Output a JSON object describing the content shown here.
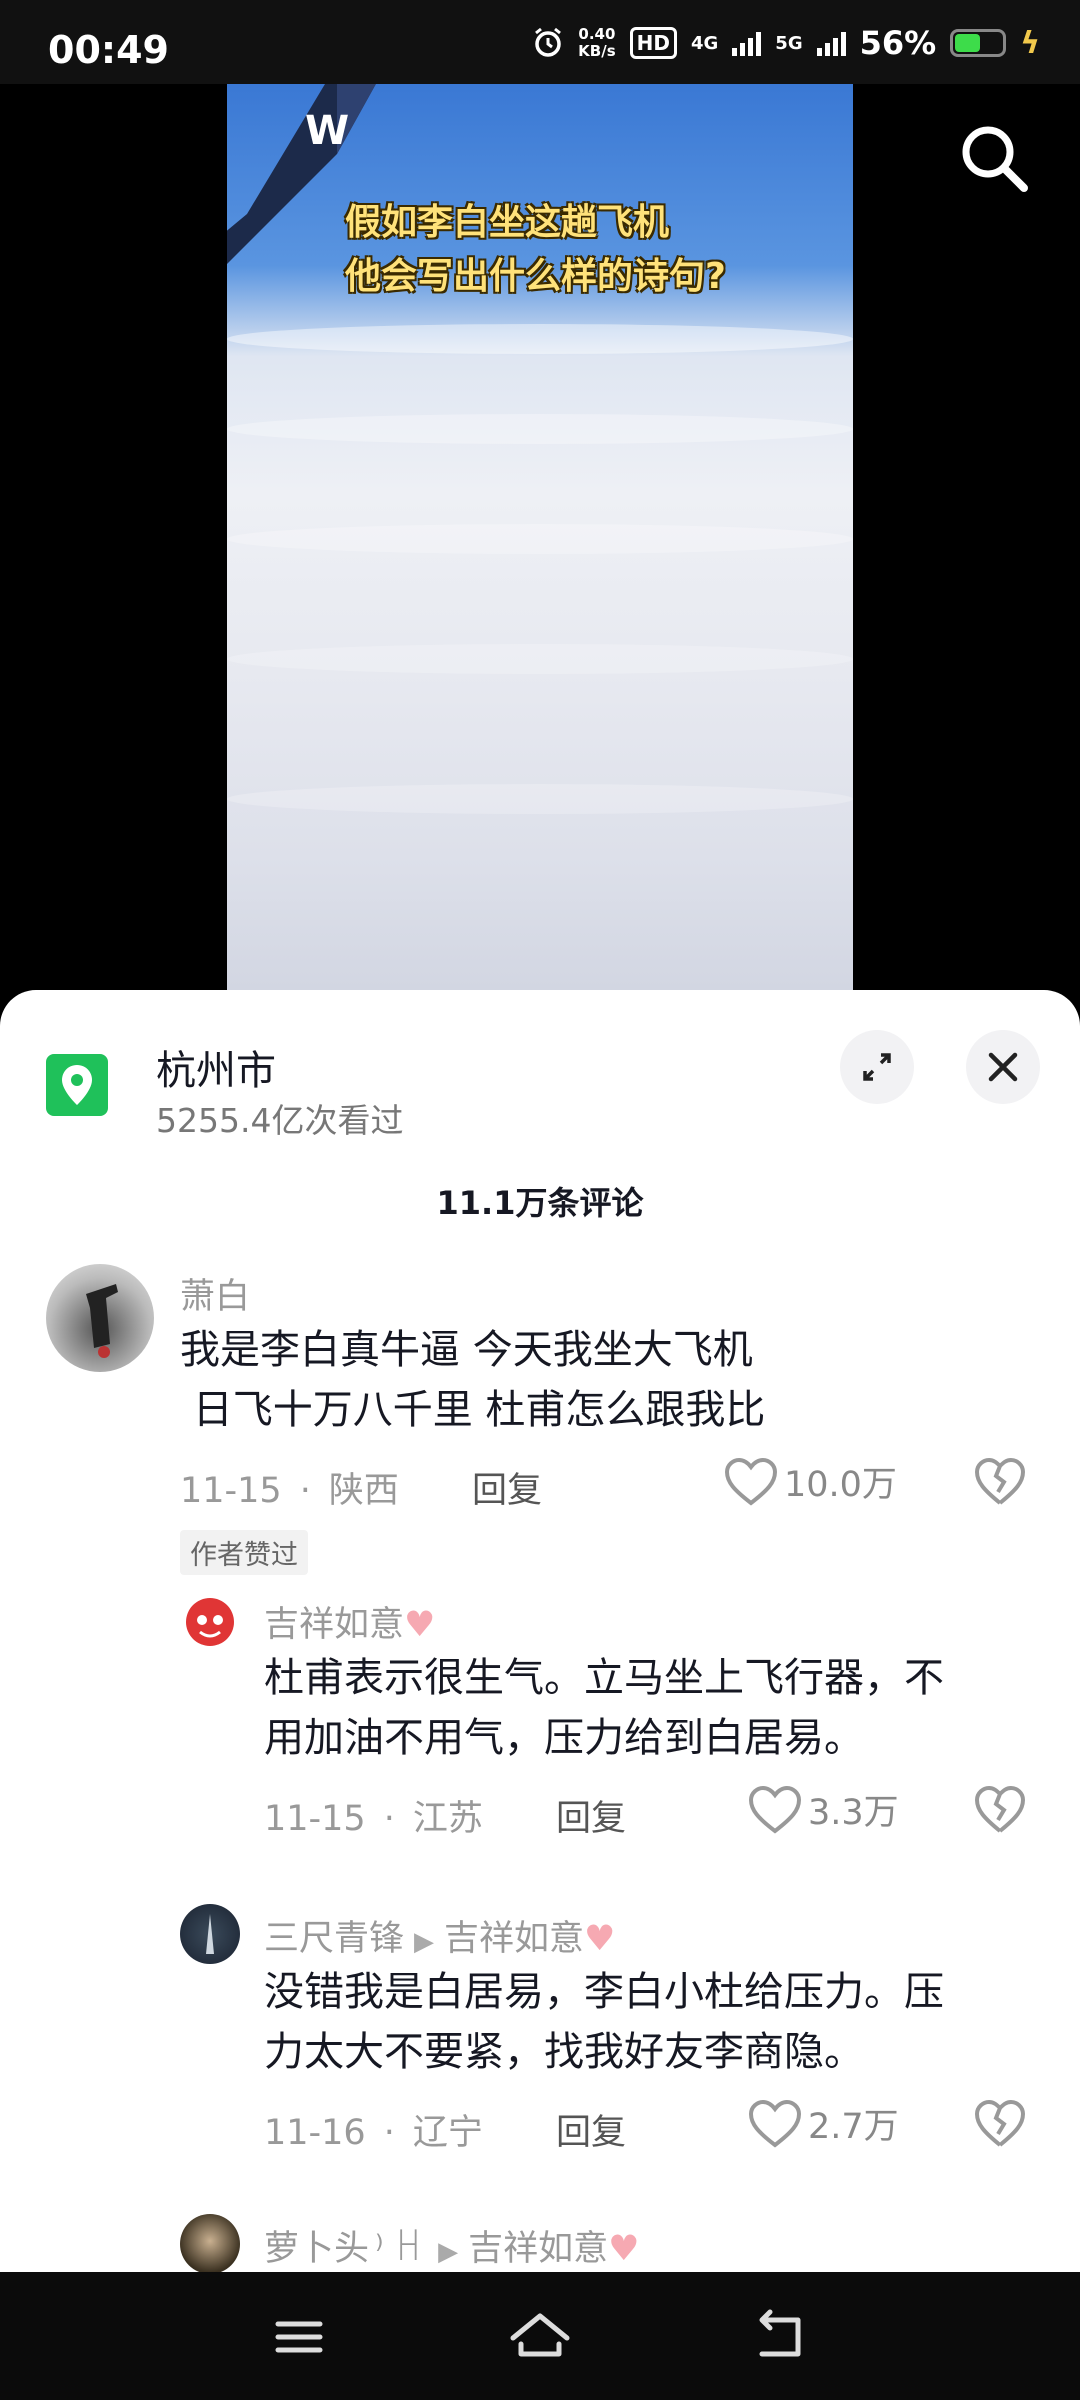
{
  "status_bar": {
    "time": "00:49",
    "net_speed": "0.40",
    "net_unit": "KB/s",
    "hd_label": "HD",
    "sim1_net": "4G",
    "sim2_net": "5G",
    "battery_percent": "56%",
    "battery_level": 0.56
  },
  "video": {
    "caption_line1": "假如李白坐这趟飞机",
    "caption_line2": "他会写出什么样的诗句?"
  },
  "location": {
    "title": "杭州市",
    "views": "5255.4亿次看过"
  },
  "comments_header": "11.1万条评论",
  "comments": [
    {
      "user": "萧白",
      "text_line1": "我是李白真牛逼 今天我坐大飞机",
      "text_line2": " 日飞十万八千里 杜甫怎么跟我比",
      "date": "11-15",
      "region": "陕西",
      "reply_label": "回复",
      "likes": "10.0万",
      "author_tag": "作者赞过"
    }
  ],
  "replies": [
    {
      "user": "吉祥如意",
      "text_line1": "杜甫表示很生气。立马坐上飞行器，不",
      "text_line2": "用加油不用气，压力给到白居易。",
      "date": "11-15",
      "region": "江苏",
      "reply_label": "回复",
      "likes": "3.3万"
    },
    {
      "user": "三尺青锋",
      "reply_to": "吉祥如意",
      "text_line1": "没错我是白居易，李白小杜给压力。压",
      "text_line2": "力太大不要紧，找我好友李商隐。",
      "date": "11-16",
      "region": "辽宁",
      "reply_label": "回复",
      "likes": "2.7万"
    },
    {
      "user": "萝卜头",
      "reply_to": "吉祥如意"
    }
  ],
  "icons": {
    "search": "search-icon",
    "location": "location-pin-icon",
    "expand": "expand-icon",
    "close": "close-icon",
    "like": "heart-icon",
    "dislike": "broken-heart-icon",
    "nav_menu": "menu-icon",
    "nav_home": "home-icon",
    "nav_back": "back-icon"
  },
  "colors": {
    "accent_green": "#1fc15a",
    "caption_yellow": "#ffe27a",
    "heart_pink": "#f6a9b2"
  }
}
